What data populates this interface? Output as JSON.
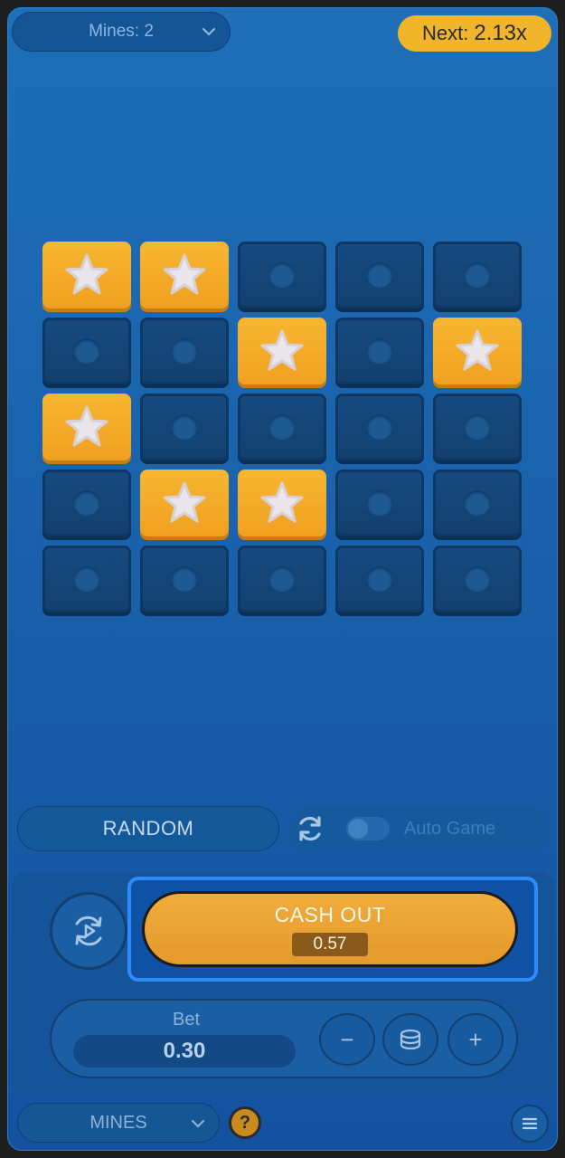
{
  "topbar": {
    "mines_label": "Mines: 2",
    "next_label": "Next:",
    "next_value": "2.13x"
  },
  "grid": {
    "rows": [
      [
        "star",
        "closed",
        "closed",
        "closed",
        "closed"
      ],
      [
        "closed",
        "closed",
        "star",
        "closed",
        "star"
      ],
      [
        "star",
        "closed",
        "closed",
        "closed",
        "closed"
      ],
      [
        "closed",
        "star",
        "star",
        "closed",
        "closed"
      ],
      [
        "closed",
        "closed",
        "closed",
        "closed",
        "closed"
      ]
    ],
    "row0_override": [
      "star",
      "star",
      "closed",
      "closed",
      "closed"
    ]
  },
  "controls": {
    "random_label": "RANDOM",
    "auto_game_label": "Auto Game",
    "auto_game_enabled": false
  },
  "bet_panel": {
    "cash_out_label": "CASH OUT",
    "cash_out_amount": "0.57",
    "bet_label": "Bet",
    "bet_value": "0.30",
    "minus_symbol": "−",
    "plus_symbol": "+"
  },
  "bottombar": {
    "game_label": "MINES",
    "help_symbol": "?"
  },
  "colors": {
    "background": "#1a63ad",
    "star_tile": "#f7b632",
    "closed_tile": "#12406f",
    "next_badge": "#f0b52a",
    "cash_out": "#e49a2c",
    "highlight_outline": "#2a8cff"
  },
  "icons": {
    "star": "star-icon",
    "cell": "dot-icon",
    "sync": "sync-icon",
    "cycle": "autoplay-cycle-icon",
    "coins": "coins-icon",
    "chevron": "chevron-down-icon",
    "menu": "menu-icon"
  }
}
